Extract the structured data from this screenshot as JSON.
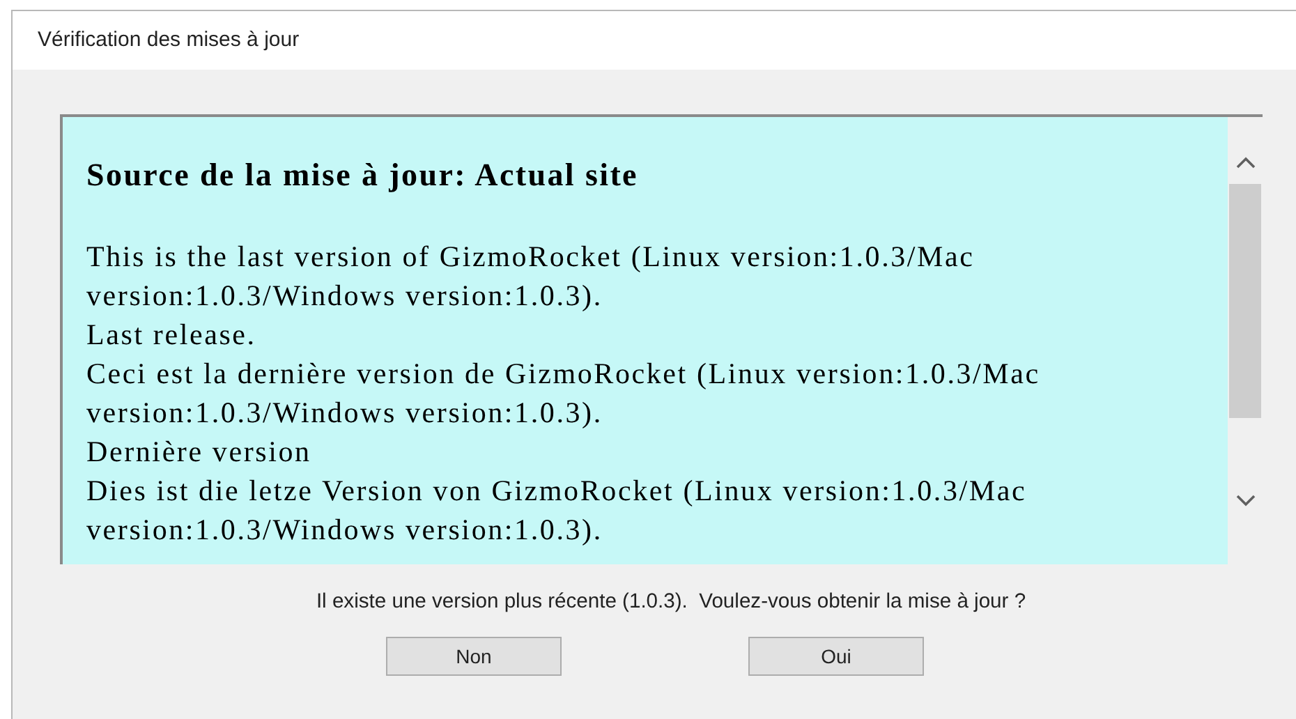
{
  "window": {
    "title": "Vérification des mises à jour"
  },
  "content": {
    "heading": "Source de la mise à jour: Actual site",
    "paragraphs": [
      "This is the last version of GizmoRocket (Linux version:1.0.3/Mac version:1.0.3/Windows version:1.0.3).",
      "Last release.",
      "Ceci est la dernière version de GizmoRocket (Linux version:1.0.3/Mac version:1.0.3/Windows version:1.0.3).",
      "Dernière version",
      "Dies ist die letze Version von GizmoRocket (Linux version:1.0.3/Mac version:1.0.3/Windows version:1.0.3)."
    ]
  },
  "message": "Il existe une version plus récente (1.0.3).  Voulez-vous obtenir la mise à jour ?",
  "buttons": [
    "Non",
    "Oui"
  ]
}
